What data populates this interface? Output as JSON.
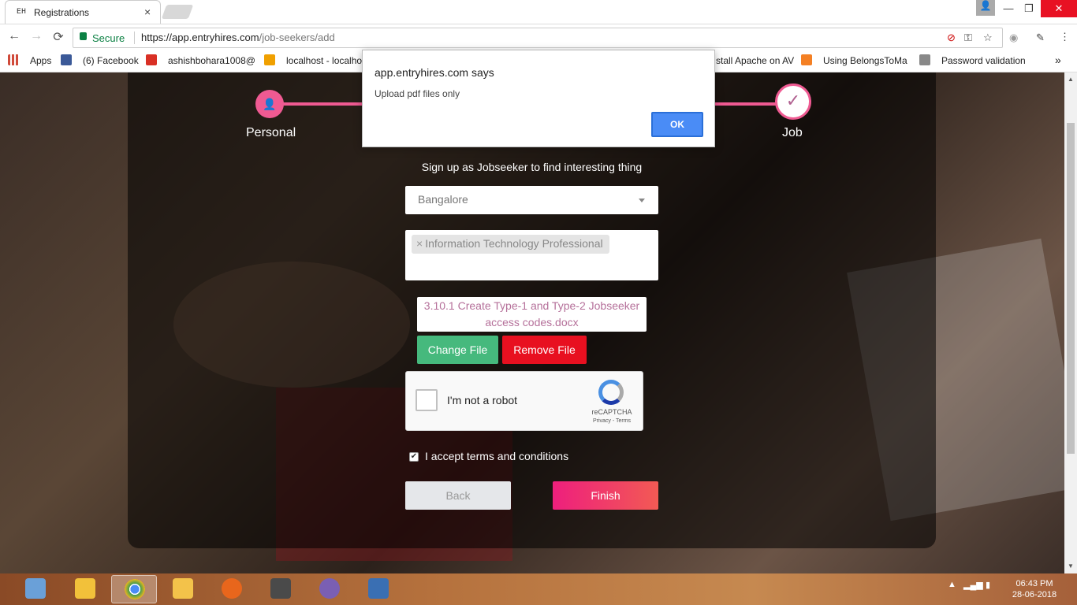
{
  "tab": {
    "favicon": "EH",
    "title": "Registrations",
    "close": "×"
  },
  "window": {
    "minimize": "—",
    "restore": "❐",
    "close": "✕",
    "user": "👤"
  },
  "toolbar": {
    "back": "←",
    "forward": "→",
    "reload": "⟳"
  },
  "address": {
    "secure_label": "Secure",
    "url_host": "https://app.entryhires.com",
    "url_path": "/job-seekers/add"
  },
  "omnibox_icons": [
    "blocked-icon",
    "key-icon",
    "star-icon",
    "camera-icon",
    "extension-icon",
    "menu-icon"
  ],
  "bookmarks": [
    {
      "label": "Apps",
      "icon": "apps-grid-icon",
      "color": "#d04a3a"
    },
    {
      "label": "(6) Facebook",
      "icon": "facebook-icon",
      "color": "#3b5998"
    },
    {
      "label": "ashishbohara1008@",
      "icon": "gmail-icon",
      "color": "#d93025"
    },
    {
      "label": "localhost - localho",
      "icon": "phpmyadmin-icon",
      "color": "#f0a000"
    },
    {
      "label": "stall Apache on AV",
      "icon": "bookmark-icon",
      "color": "#888888"
    },
    {
      "label": "Using BelongsToMa",
      "icon": "stackoverflow-icon",
      "color": "#f48024"
    },
    {
      "label": "Password validation",
      "icon": "avatar-icon",
      "color": "#888888"
    }
  ],
  "bookmarks_more": "»",
  "steps": {
    "first_label": "Personal",
    "last_label": "Job",
    "first_icon": "👤",
    "last_icon": "✓"
  },
  "form": {
    "subtitle": "Sign up as Jobseeker to find interesting thing",
    "city_value": "Bangalore",
    "tag_remove": "×",
    "tag_label": "Information Technology Professional",
    "file_name": "3.10.1 Create Type-1 and Type-2 Jobseeker access codes.docx",
    "change_file": "Change File",
    "remove_file": "Remove File",
    "captcha_label": "I'm not a robot",
    "captcha_brand": "reCAPTCHA",
    "captcha_links": "Privacy - Terms",
    "terms_check": "✔",
    "terms_label": "I accept terms and conditions",
    "back": "Back",
    "finish": "Finish"
  },
  "dialog": {
    "title": "app.entryhires.com says",
    "message": "Upload pdf files only",
    "ok": "OK"
  },
  "taskbar": {
    "items": [
      {
        "icon": "calculator-icon",
        "color": "#6aa0d8"
      },
      {
        "icon": "outlook-icon",
        "color": "#f2c13a"
      },
      {
        "icon": "chrome-icon",
        "color": "#3f9a4f"
      },
      {
        "icon": "file-explorer-icon",
        "color": "#f3c24a"
      },
      {
        "icon": "firefox-icon",
        "color": "#e8661c"
      },
      {
        "icon": "sublime-text-icon",
        "color": "#4a4a4a"
      },
      {
        "icon": "github-desktop-icon",
        "color": "#7a5fb3"
      },
      {
        "icon": "network-tool-icon",
        "color": "#3a6fb3"
      }
    ],
    "time": "06:43 PM",
    "date": "28-06-2018"
  },
  "colors": {
    "accent_pink": "#ef5a92",
    "change_green": "#46b97d",
    "remove_red": "#e81020",
    "ok_blue": "#4a8cf6"
  }
}
